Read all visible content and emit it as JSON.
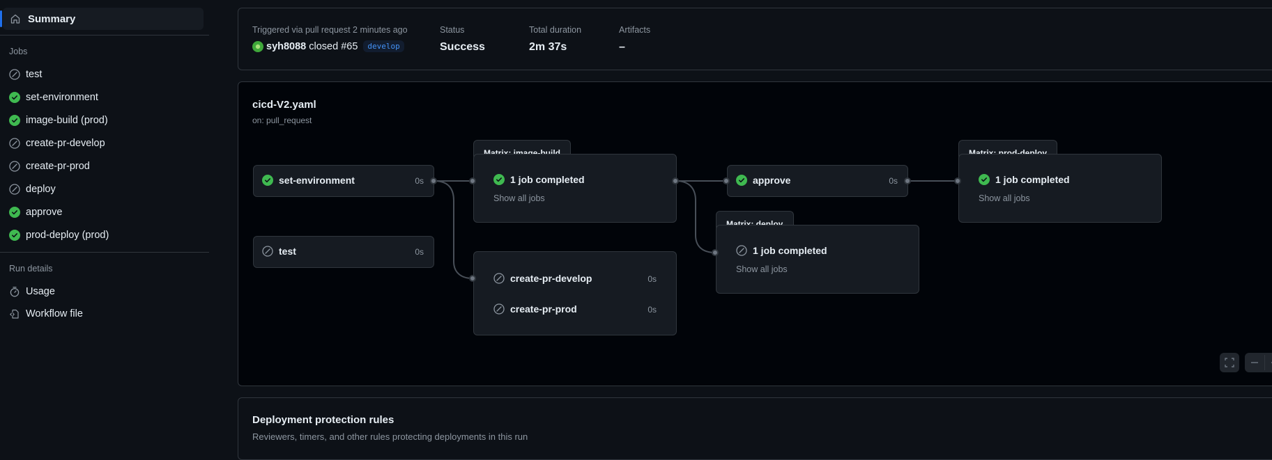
{
  "sidebar": {
    "summary_label": "Summary",
    "jobs_heading": "Jobs",
    "jobs": [
      {
        "label": "test",
        "status": "skipped"
      },
      {
        "label": "set-environment",
        "status": "success"
      },
      {
        "label": "image-build (prod)",
        "status": "success"
      },
      {
        "label": "create-pr-develop",
        "status": "skipped"
      },
      {
        "label": "create-pr-prod",
        "status": "skipped"
      },
      {
        "label": "deploy",
        "status": "skipped"
      },
      {
        "label": "approve",
        "status": "success"
      },
      {
        "label": "prod-deploy (prod)",
        "status": "success"
      }
    ],
    "run_details_heading": "Run details",
    "run_details": [
      {
        "label": "Usage",
        "icon": "stopwatch-icon"
      },
      {
        "label": "Workflow file",
        "icon": "file-code-icon"
      }
    ]
  },
  "summary": {
    "trigger_label": "Triggered via pull request 2 minutes ago",
    "user": "syh8088",
    "action": "closed #65",
    "branch": "develop",
    "status_label": "Status",
    "status_value": "Success",
    "duration_label": "Total duration",
    "duration_value": "2m 37s",
    "artifacts_label": "Artifacts",
    "artifacts_value": "–"
  },
  "graph": {
    "workflow_file": "cicd-V2.yaml",
    "trigger": "on: pull_request",
    "jobs": {
      "set_environment": {
        "label": "set-environment",
        "duration": "0s",
        "status": "success"
      },
      "test": {
        "label": "test",
        "duration": "0s",
        "status": "skipped"
      },
      "approve": {
        "label": "approve",
        "duration": "0s",
        "status": "success"
      },
      "create_pr_develop": {
        "label": "create-pr-develop",
        "duration": "0s",
        "status": "skipped"
      },
      "create_pr_prod": {
        "label": "create-pr-prod",
        "duration": "0s",
        "status": "skipped"
      }
    },
    "matrices": {
      "image_build": {
        "title": "Matrix: image-build",
        "summary": "1 job completed",
        "link": "Show all jobs",
        "status": "success"
      },
      "deploy": {
        "title": "Matrix: deploy",
        "summary": "1 job completed",
        "link": "Show all jobs",
        "status": "skipped"
      },
      "prod_deploy": {
        "title": "Matrix: prod-deploy",
        "summary": "1 job completed",
        "link": "Show all jobs",
        "status": "success"
      }
    }
  },
  "deployment": {
    "title": "Deployment protection rules",
    "description": "Reviewers, timers, and other rules protecting deployments in this run"
  },
  "colors": {
    "success": "#3fb950",
    "skipped": "#8d96a0",
    "accent": "#1f6feb",
    "branch": "#4493f8"
  }
}
